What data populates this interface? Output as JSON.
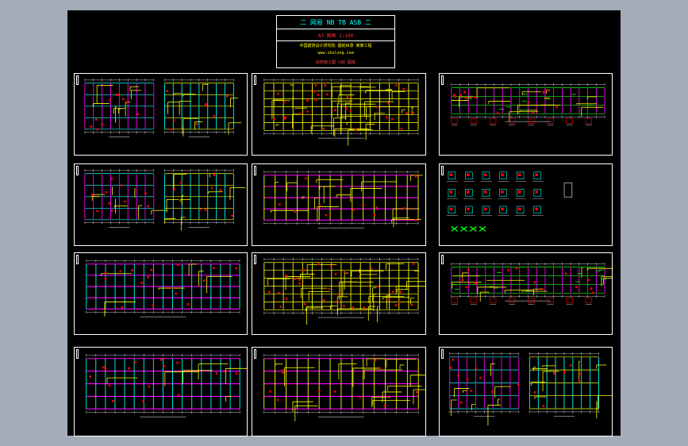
{
  "drawing": {
    "background_color": "#a3acb8",
    "sheet_color": "#000000",
    "line_colors": {
      "axis": "#ffffff",
      "beam": "#ffff00",
      "column": "#ff00ff",
      "grid": "#00ffff",
      "rebar": "#ff0000",
      "detail": "#00ff00"
    },
    "title_block": {
      "line1": "二 网易 NB TB ASB 二",
      "line2": "A3 图框 1:100",
      "line3": "中国建筑设计研究院 图纸目录 某某工程",
      "line4": "www.zhulong.com",
      "line5": "结构施工图 CAD 图纸"
    },
    "sheets": [
      {
        "id": "sheet-1-1",
        "type": "plan-pair"
      },
      {
        "id": "sheet-1-2",
        "type": "plan-dense"
      },
      {
        "id": "sheet-1-3",
        "type": "plan-strip"
      },
      {
        "id": "sheet-2-1",
        "type": "plan-pair"
      },
      {
        "id": "sheet-2-2",
        "type": "plan-beams"
      },
      {
        "id": "sheet-2-3",
        "type": "details"
      },
      {
        "id": "sheet-3-1",
        "type": "plan-grid"
      },
      {
        "id": "sheet-3-2",
        "type": "plan-dense"
      },
      {
        "id": "sheet-3-3",
        "type": "plan-strip"
      },
      {
        "id": "sheet-4-1",
        "type": "plan-grid"
      },
      {
        "id": "sheet-4-2",
        "type": "plan-beams"
      },
      {
        "id": "sheet-4-3",
        "type": "plan-pair"
      }
    ]
  }
}
